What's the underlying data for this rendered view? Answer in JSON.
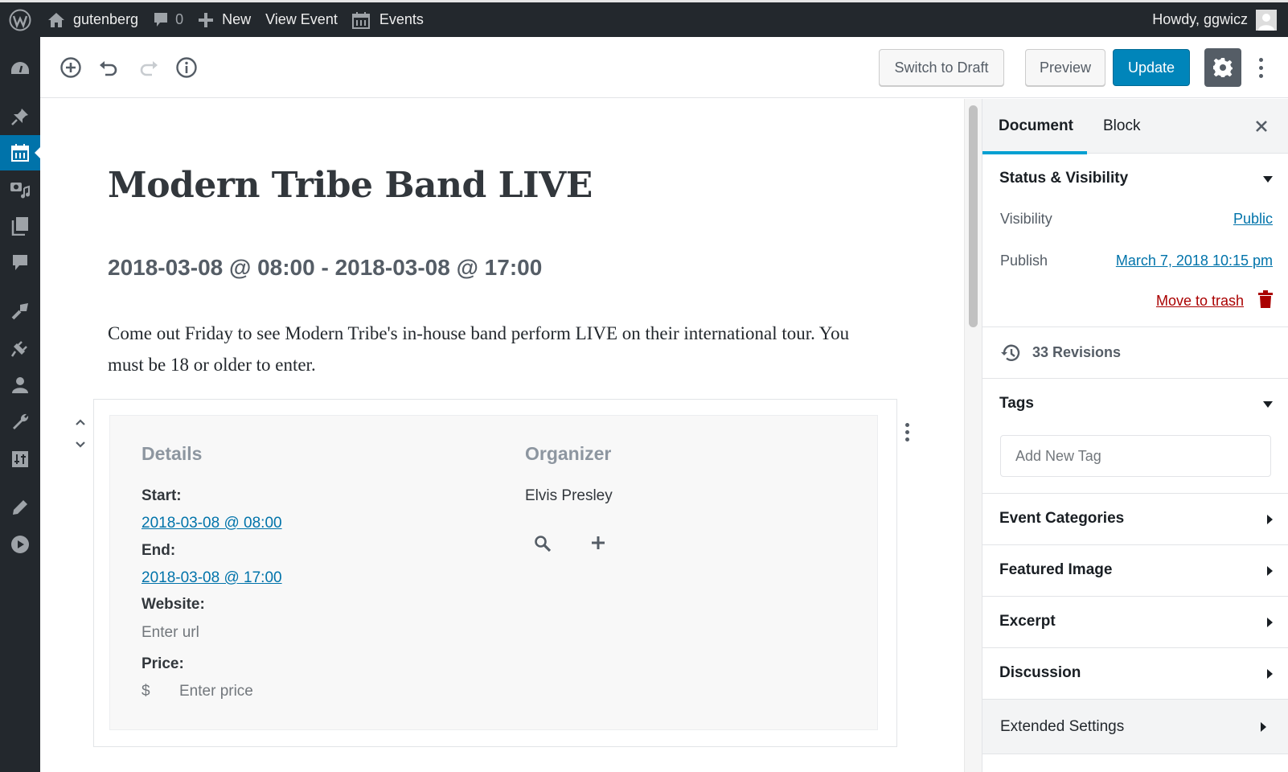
{
  "adminbar": {
    "site_name": "gutenberg",
    "comments_count": "0",
    "new_label": "New",
    "view_label": "View Event",
    "events_label": "Events",
    "howdy": "Howdy, ggwicz"
  },
  "adminmenu": {
    "items": [
      {
        "icon": "dashboard-icon"
      },
      {
        "icon": "pin-icon"
      },
      {
        "icon": "calendar-icon",
        "active": true
      },
      {
        "icon": "media-icon"
      },
      {
        "icon": "pages-icon"
      },
      {
        "icon": "comments-icon"
      },
      {
        "icon": "appearance-icon"
      },
      {
        "icon": "plugins-icon"
      },
      {
        "icon": "users-icon"
      },
      {
        "icon": "tools-icon"
      },
      {
        "icon": "settings-icon"
      },
      {
        "icon": "pencil-icon"
      },
      {
        "icon": "play-icon"
      }
    ]
  },
  "toolbar": {
    "switch_draft": "Switch to Draft",
    "preview": "Preview",
    "update": "Update"
  },
  "post": {
    "title": "Modern Tribe Band LIVE",
    "dates": "2018-03-08 @ 08:00 - 2018-03-08 @ 17:00",
    "description": "Come out Friday to see Modern Tribe's in-house band perform LIVE on their international tour. You must be 18 or older to enter."
  },
  "event_block": {
    "details_title": "Details",
    "start_label": "Start:",
    "start_value": "2018-03-08 @ 08:00",
    "end_label": "End:",
    "end_value": "2018-03-08 @ 17:00",
    "website_label": "Website:",
    "website_placeholder": "Enter url",
    "price_label": "Price:",
    "currency": "$",
    "price_placeholder": "Enter price",
    "organizer_title": "Organizer",
    "organizer_name": "Elvis Presley"
  },
  "sidebar": {
    "tabs": [
      {
        "label": "Document",
        "active": true
      },
      {
        "label": "Block",
        "active": false
      }
    ],
    "status": {
      "title": "Status & Visibility",
      "visibility_label": "Visibility",
      "visibility_value": "Public",
      "publish_label": "Publish",
      "publish_value": "March 7, 2018 10:15 pm",
      "trash_label": "Move to trash"
    },
    "revisions": "33 Revisions",
    "tags": {
      "title": "Tags",
      "placeholder": "Add New Tag"
    },
    "panels": [
      {
        "title": "Event Categories"
      },
      {
        "title": "Featured Image"
      },
      {
        "title": "Excerpt"
      },
      {
        "title": "Discussion"
      },
      {
        "title": "Extended Settings"
      }
    ]
  },
  "colors": {
    "primary": "#0085ba",
    "link": "#0073aa",
    "danger": "#a00",
    "admin_dark": "#23282d",
    "tab_accent": "#00a0d2"
  }
}
